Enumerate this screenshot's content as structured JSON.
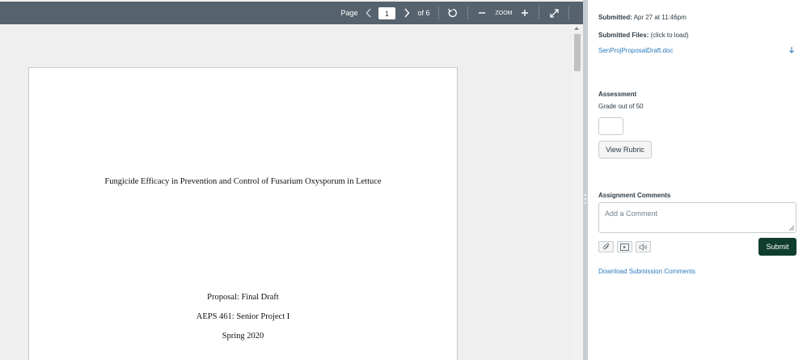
{
  "toolbar": {
    "page_label": "Page",
    "page_value": "1",
    "page_total": "of 6",
    "zoom_label": "ZOOM"
  },
  "document": {
    "title": "Fungicide Efficacy in Prevention and Control of Fusarium Oxysporum in Lettuce",
    "line1": "Proposal: Final Draft",
    "line2": "AEPS 461:  Senior Project I",
    "line3": "Spring 2020"
  },
  "panel": {
    "submitted_label": "Submitted:",
    "submitted_value": "Apr 27 at 11:46pm",
    "files_label": "Submitted Files:",
    "files_hint": "(click to load)",
    "file_name": "SenProjProposalDraft.doc",
    "assessment_title": "Assessment",
    "grade_label": "Grade out of 50",
    "grade_value": "",
    "view_rubric": "View Rubric",
    "comments_title": "Assignment Comments",
    "comment_placeholder": "Add a Comment",
    "submit_label": "Submit",
    "download_comments": "Download Submission Comments"
  },
  "colors": {
    "toolbar_bg": "#56636e",
    "link": "#2b7abc",
    "submit_bg": "#0f3d2e"
  }
}
